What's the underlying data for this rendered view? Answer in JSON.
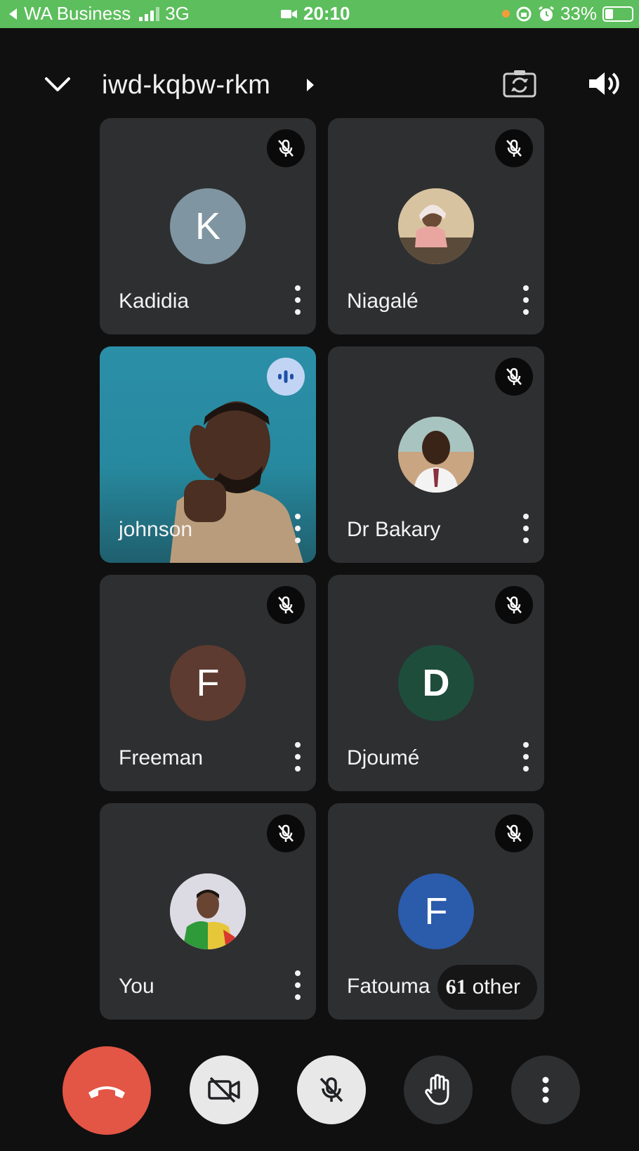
{
  "status_bar": {
    "back_app": "WA Business",
    "network": "3G",
    "time": "20:10",
    "battery": "33%"
  },
  "header": {
    "meeting_code": "iwd-kqbw-rkm"
  },
  "participants": [
    {
      "name": "Kadidia",
      "initial": "K",
      "avatar_color": "#7f95a2",
      "muted": true
    },
    {
      "name": "Niagalé",
      "initial": "",
      "avatar_color": "#c9b08a",
      "muted": true
    },
    {
      "name": "johnson",
      "initial": "",
      "avatar_color": "",
      "muted": false,
      "speaking": true
    },
    {
      "name": "Dr Bakary",
      "initial": "",
      "avatar_color": "#b58a6a",
      "muted": true
    },
    {
      "name": "Freeman",
      "initial": "F",
      "avatar_color": "#5e3b30",
      "muted": true
    },
    {
      "name": "Djoumé",
      "initial": "D",
      "avatar_color": "#1e4d3c",
      "muted": true
    },
    {
      "name": "You",
      "initial": "",
      "avatar_color": "#d6d3dc",
      "muted": true
    },
    {
      "name": "Fatouma",
      "initial": "F",
      "avatar_color": "#2b5bab",
      "muted": true
    }
  ],
  "others": {
    "count": "61",
    "label": "other"
  },
  "colors": {
    "status_bar": "#5cbe5c",
    "tile_bg": "#2e2f31",
    "hangup": "#e35545",
    "speaking_badge": "#c2d4f4"
  }
}
